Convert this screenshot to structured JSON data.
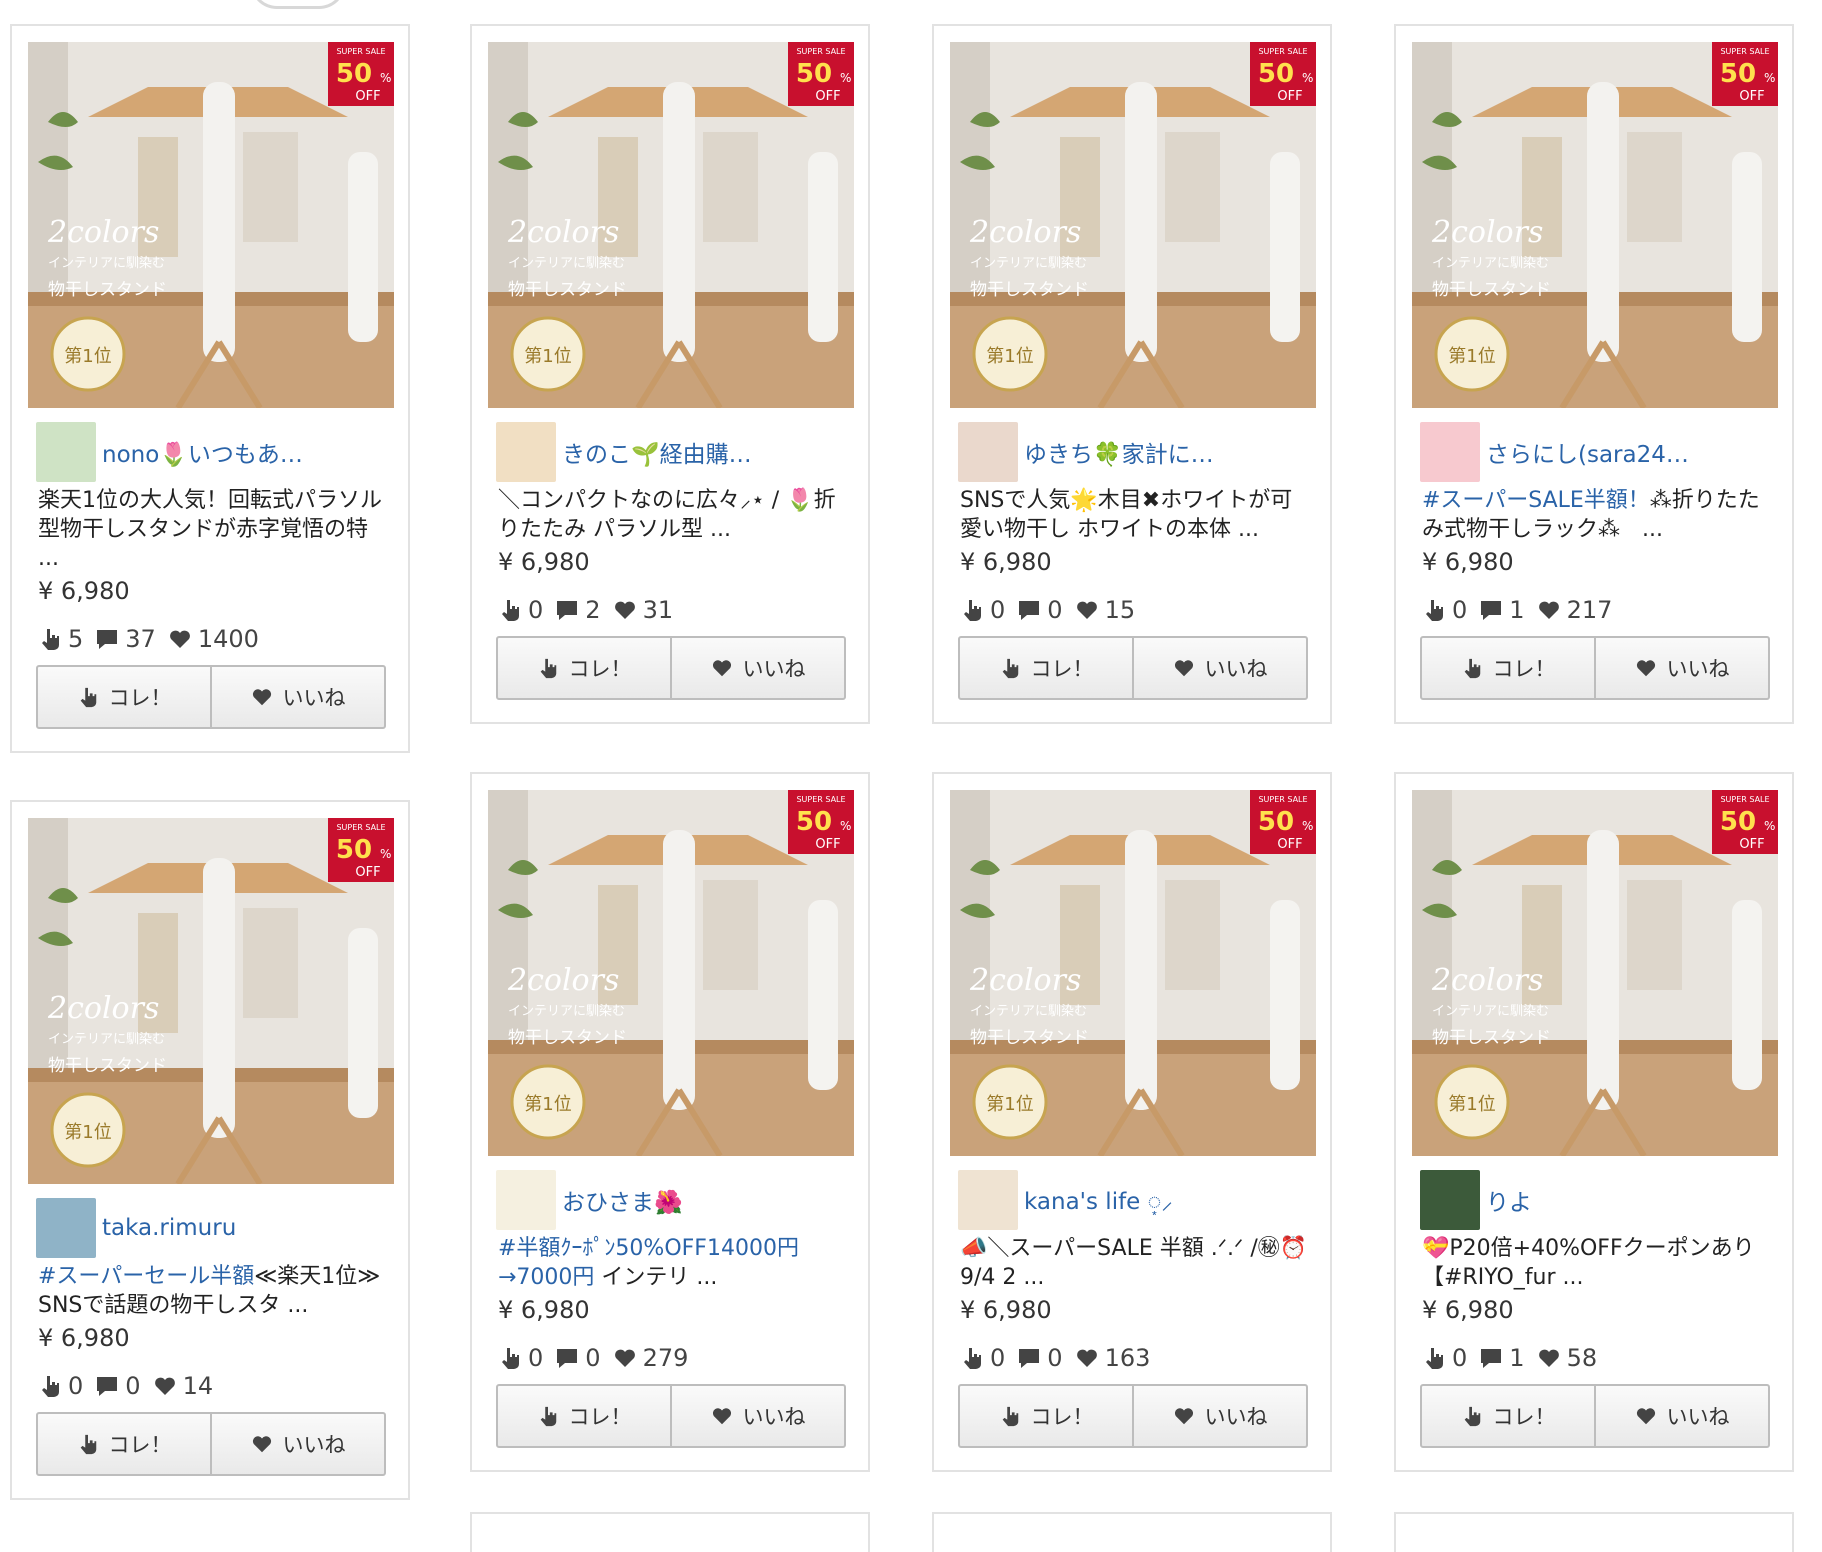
{
  "product_badge": {
    "super_sale": "SUPER SALE",
    "percent": "50",
    "off": "OFF"
  },
  "product_image": {
    "tagline": "2colors",
    "subtitle": "インテリアに馴染む",
    "title": "物干しスタンド",
    "rank": "第1位"
  },
  "buttons": {
    "kore": "コレ！",
    "iine": "いいね"
  },
  "cards": [
    {
      "username": "nono🌷いつもあ…",
      "desc_tag": "",
      "desc": "楽天1位の大人気！回転式パラソル型物干しスタンドが赤字覚悟の特 ...",
      "price": "¥ 6,980",
      "kore": "5",
      "comments": "37",
      "likes": "1400"
    },
    {
      "username": "きのこ🌱経由購…",
      "desc_tag": "",
      "desc": "＼コンパクトなのに広々⸝⋆ / 🌷折りたたみ パラソル型 ...",
      "price": "¥ 6,980",
      "kore": "0",
      "comments": "2",
      "likes": "31"
    },
    {
      "username": "ゆきち🍀家計に…",
      "desc_tag": "",
      "desc": "SNSで人気🌟木目✖︎ホワイトが可愛い物干し ホワイトの本体 ...",
      "price": "¥ 6,980",
      "kore": "0",
      "comments": "0",
      "likes": "15"
    },
    {
      "username": "さらにし(sara24…",
      "desc_tag": "#スーパーSALE半額！",
      "desc": "⁂折りたたみ式物干しラック⁂　...",
      "price": "¥ 6,980",
      "kore": "0",
      "comments": "1",
      "likes": "217"
    },
    {
      "username": "taka.rimuru",
      "desc_tag": "#スーパーセール半額",
      "desc": "≪楽天1位≫ SNSで話題の物干しスタ ...",
      "price": "¥ 6,980",
      "kore": "0",
      "comments": "0",
      "likes": "14"
    },
    {
      "username": "おひさま🌺",
      "desc_tag": "#半額ｸｰﾎﾟﾝ50%OFF14000円→7000円",
      "desc": " インテリ ...",
      "price": "¥ 6,980",
      "kore": "0",
      "comments": "0",
      "likes": "279"
    },
    {
      "username": "kana's life ◌͙⸝",
      "desc_tag": "",
      "desc": "📣＼スーパーSALE 半額 .ᐟ.ᐟ /㊙︎⏰9/4 2 ...",
      "price": "¥ 6,980",
      "kore": "0",
      "comments": "0",
      "likes": "163"
    },
    {
      "username": "りよ",
      "desc_tag": "",
      "desc": "💝P20倍+40%OFFクーポンあり【#RIYO_fur ...",
      "price": "¥ 6,980",
      "kore": "0",
      "comments": "1",
      "likes": "58"
    }
  ],
  "colors": {
    "link": "#2a63a8",
    "badge_red": "#c8102e",
    "border": "#e2e2e2"
  }
}
